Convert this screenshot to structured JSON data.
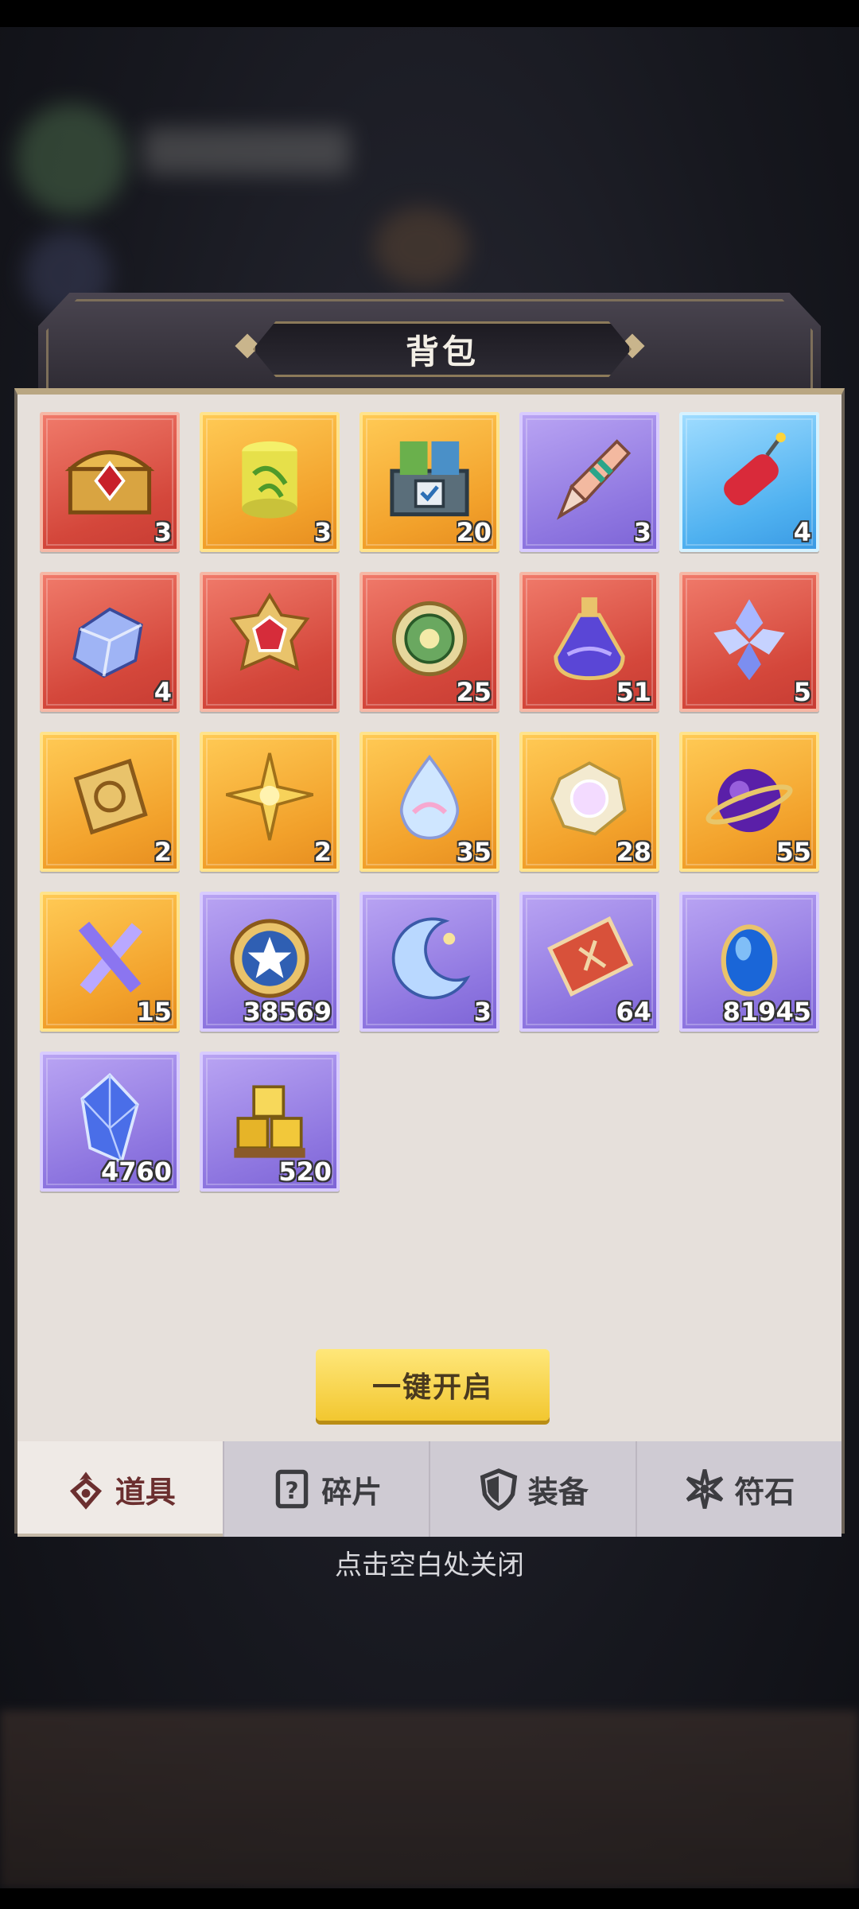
{
  "panel": {
    "title": "背包"
  },
  "items": [
    {
      "rarity": "red",
      "icon": "treasure-chest-icon",
      "qty": "3"
    },
    {
      "rarity": "gold",
      "icon": "scroll-drum-icon",
      "qty": "3"
    },
    {
      "rarity": "gold",
      "icon": "card-chest-icon",
      "qty": "20"
    },
    {
      "rarity": "purple",
      "icon": "firework-rocket-icon",
      "qty": "3"
    },
    {
      "rarity": "blue",
      "icon": "firecracker-icon",
      "qty": "4"
    },
    {
      "rarity": "red",
      "icon": "crystal-cube-icon",
      "qty": "4"
    },
    {
      "rarity": "red",
      "icon": "gold-emblem-icon",
      "qty": ""
    },
    {
      "rarity": "red",
      "icon": "green-medallion-icon",
      "qty": "25"
    },
    {
      "rarity": "red",
      "icon": "potion-flask-icon",
      "qty": "51"
    },
    {
      "rarity": "red",
      "icon": "crystal-cluster-icon",
      "qty": "5"
    },
    {
      "rarity": "gold",
      "icon": "gold-book-icon",
      "qty": "2"
    },
    {
      "rarity": "gold",
      "icon": "gold-star-emblem-icon",
      "qty": "2"
    },
    {
      "rarity": "gold",
      "icon": "rainbow-drop-icon",
      "qty": "35"
    },
    {
      "rarity": "gold",
      "icon": "pearl-flower-icon",
      "qty": "28"
    },
    {
      "rarity": "gold",
      "icon": "cosmic-orb-icon",
      "qty": "55"
    },
    {
      "rarity": "gold",
      "icon": "crossed-crystals-icon",
      "qty": "15"
    },
    {
      "rarity": "purple",
      "icon": "star-coin-icon",
      "qty": "38569"
    },
    {
      "rarity": "purple",
      "icon": "crescent-moon-icon",
      "qty": "3"
    },
    {
      "rarity": "purple",
      "icon": "ticket-icon",
      "qty": "64"
    },
    {
      "rarity": "purple",
      "icon": "blue-gem-icon",
      "qty": "81945"
    },
    {
      "rarity": "purple",
      "icon": "diamond-crystal-icon",
      "qty": "4760"
    },
    {
      "rarity": "purple",
      "icon": "gold-ingots-icon",
      "qty": "520"
    }
  ],
  "actions": {
    "open_all_label": "一键开启"
  },
  "tabs": [
    {
      "label": "道具",
      "icon": "bag-icon",
      "active": true
    },
    {
      "label": "碎片",
      "icon": "question-card-icon",
      "active": false
    },
    {
      "label": "装备",
      "icon": "shield-icon",
      "active": false
    },
    {
      "label": "符石",
      "icon": "spark-icon",
      "active": false
    }
  ],
  "hint": "点击空白处关闭",
  "colors": {
    "red": "#d4473b",
    "gold": "#f2a12b",
    "purple": "#8e76e0",
    "blue": "#4fb1f0",
    "button": "#f2c730"
  }
}
